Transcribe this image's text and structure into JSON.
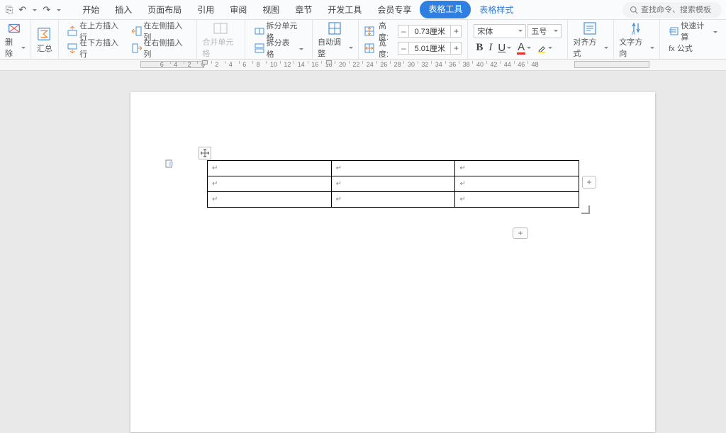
{
  "quickaccess": {
    "save": "⎘",
    "undo": "↶",
    "redo": "↷",
    "more": "▾"
  },
  "menu": {
    "items": [
      "开始",
      "插入",
      "页面布局",
      "引用",
      "审阅",
      "视图",
      "章节",
      "开发工具",
      "会员专享",
      "表格工具",
      "表格样式"
    ],
    "active_index": 9,
    "blue_index": 10
  },
  "search": {
    "placeholder": "查找命令、搜索模板"
  },
  "ribbon": {
    "delete": "删除",
    "summary": "汇总",
    "insAbove": "在上方插入行",
    "insBelow": "在下方插入行",
    "insLeft": "在左侧插入列",
    "insRight": "在右侧插入列",
    "merge": "合并单元格",
    "splitCell": "拆分单元格",
    "splitTable": "拆分表格",
    "autofit": "自动调整",
    "heightLabel": "高度:",
    "height": "0.73厘米",
    "widthLabel": "宽度:",
    "width": "5.01厘米",
    "font": "宋体",
    "fontsize": "五号",
    "B": "B",
    "I": "I",
    "U": "U",
    "A": "A",
    "align": "对齐方式",
    "textdir": "文字方向",
    "quickcalc": "快速计算",
    "formula": "fx 公式"
  },
  "ruler": {
    "min": -6,
    "max": 48
  },
  "table": {
    "rows": 3,
    "cols": 3,
    "para": "↵"
  }
}
